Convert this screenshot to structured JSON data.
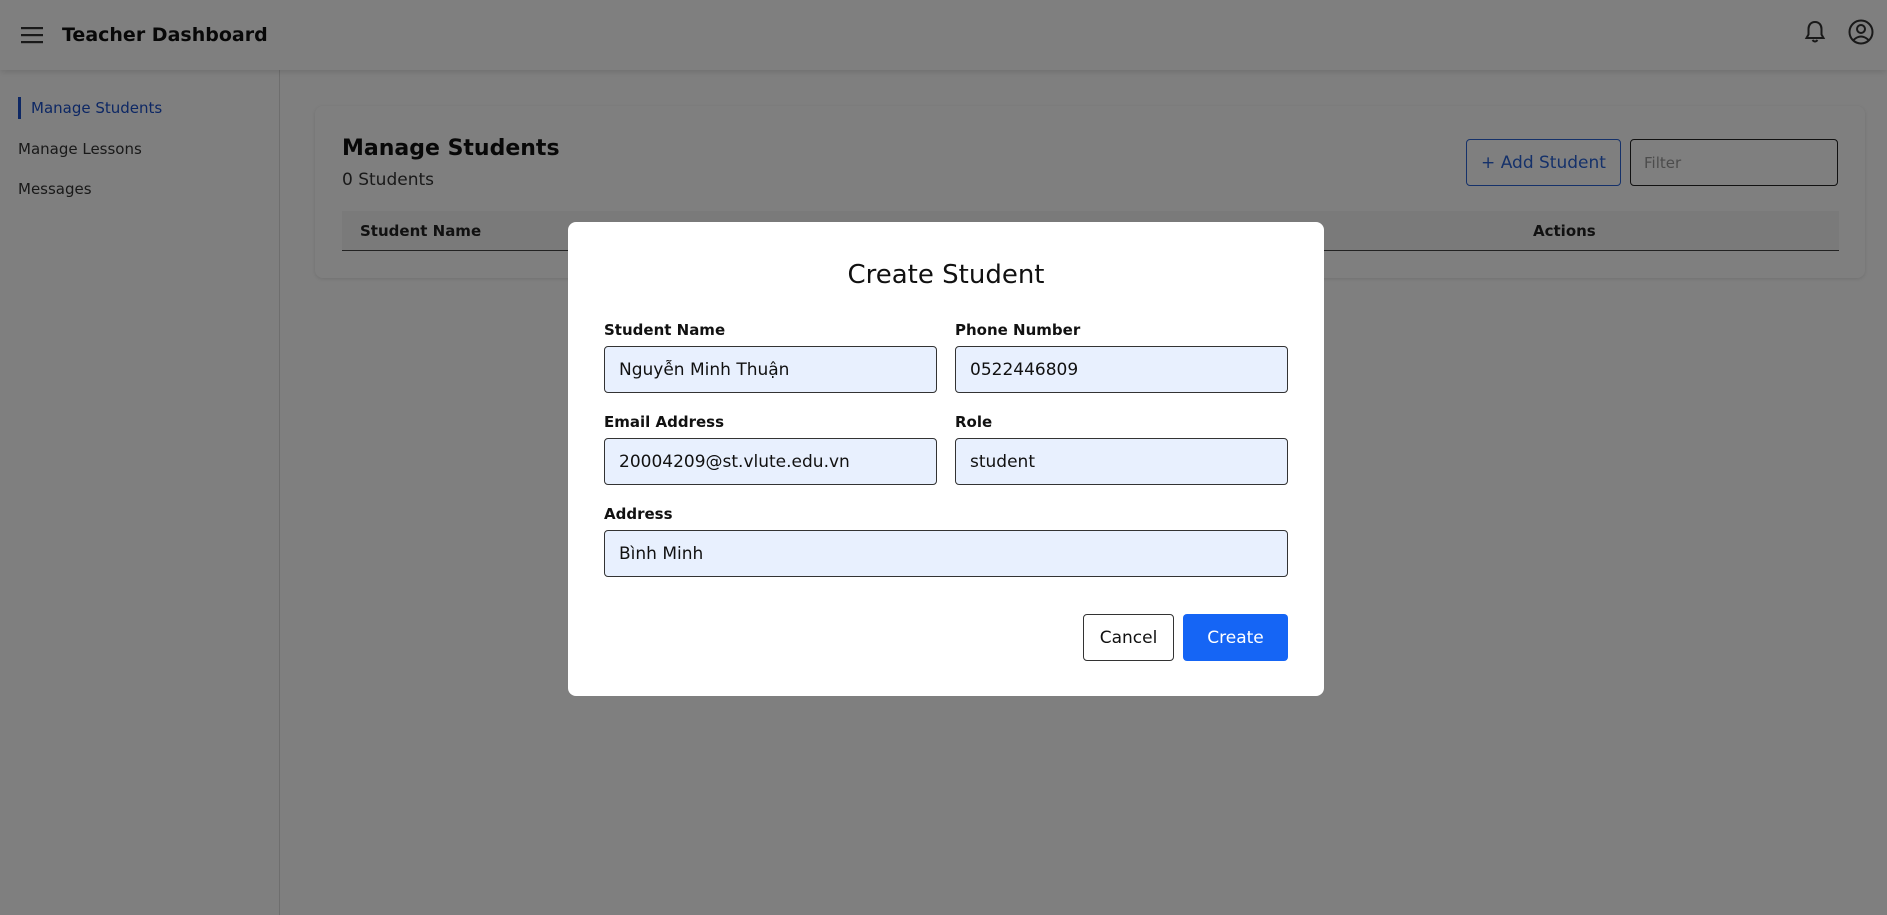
{
  "header": {
    "title": "Teacher Dashboard",
    "menu_icon": "hamburger-menu-icon",
    "notifications_icon": "bell-icon",
    "account_icon": "user-circle-icon"
  },
  "sidebar": {
    "items": [
      {
        "label": "Manage Students",
        "active": true
      },
      {
        "label": "Manage Lessons",
        "active": false
      },
      {
        "label": "Messages",
        "active": false
      }
    ]
  },
  "main": {
    "title": "Manage Students",
    "count": "0 Students",
    "add_button": "+ Add Student",
    "filter_placeholder": "Filter",
    "table": {
      "columns": [
        "Student Name",
        "Actions"
      ],
      "rows": []
    }
  },
  "modal": {
    "title": "Create Student",
    "fields": {
      "student_name": {
        "label": "Student Name",
        "value": "Nguyễn Minh Thuận"
      },
      "phone_number": {
        "label": "Phone Number",
        "value": "0522446809"
      },
      "email": {
        "label": "Email Address",
        "value": "20004209@st.vlute.edu.vn"
      },
      "role": {
        "label": "Role",
        "value": "student"
      },
      "address": {
        "label": "Address",
        "value": "Bình Minh"
      }
    },
    "cancel_label": "Cancel",
    "create_label": "Create"
  },
  "colors": {
    "accent": "#1a4fc9",
    "primary_button": "#1565f5",
    "input_background": "#e8f0fe",
    "overlay": "rgba(0,0,0,0.5)"
  }
}
